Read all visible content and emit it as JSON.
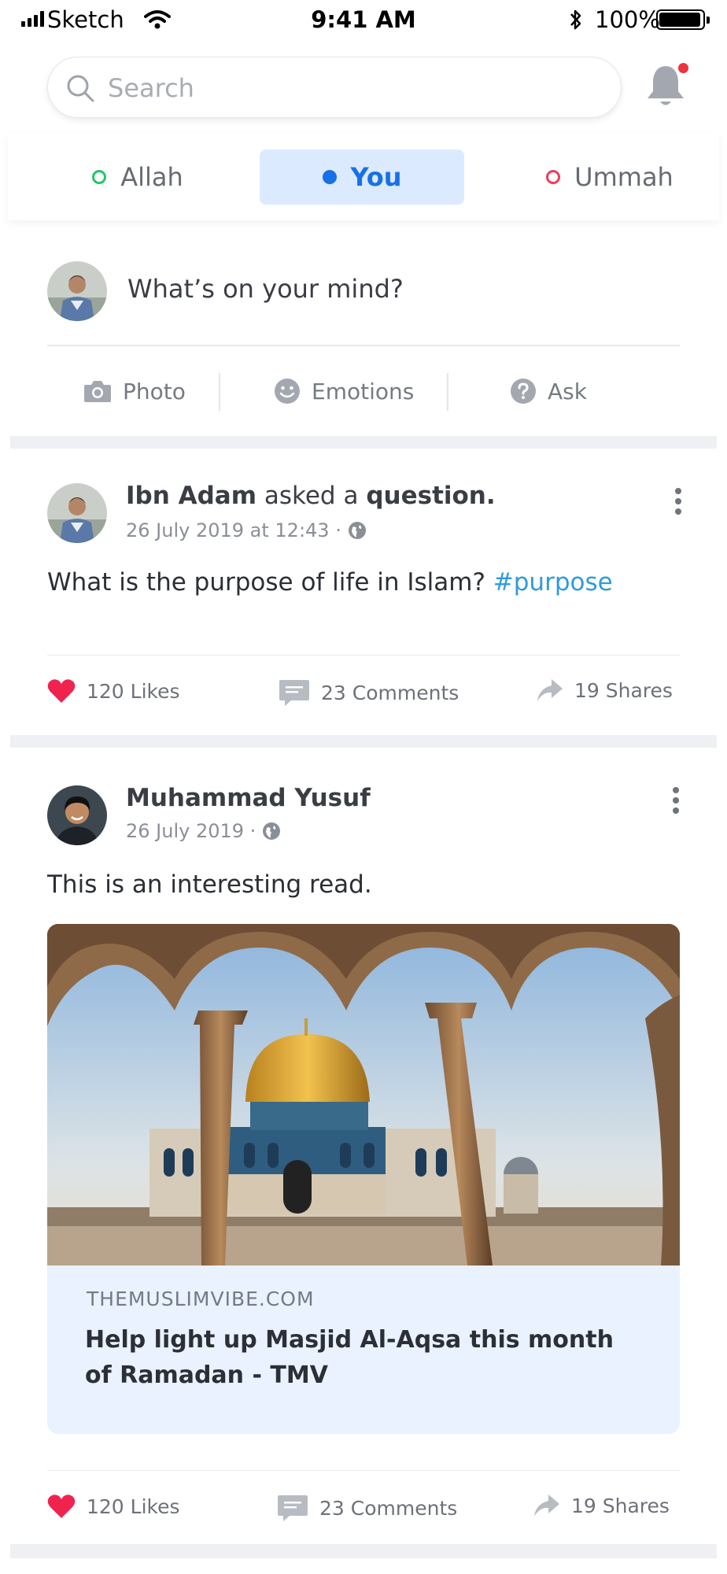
{
  "status_bar": {
    "carrier": "Sketch",
    "time": "9:41 AM",
    "battery": "100%"
  },
  "search": {
    "placeholder": "Search"
  },
  "tabs": [
    {
      "label": "Allah",
      "color": "#27c467"
    },
    {
      "label": "You",
      "color": "#1770e8"
    },
    {
      "label": "Ummah",
      "color": "#ee3d5d"
    }
  ],
  "composer": {
    "prompt": "What’s on your mind?",
    "actions": [
      {
        "label": "Photo",
        "icon": "camera-icon"
      },
      {
        "label": "Emotions",
        "icon": "smiley-icon"
      },
      {
        "label": "Ask",
        "icon": "question-icon"
      }
    ]
  },
  "posts": [
    {
      "author": "Ibn Adam",
      "action_prefix": "asked a",
      "action_object": "question.",
      "date": "26 July 2019 at 12:43 ·",
      "text": "What is the purpose of life in Islam?",
      "hashtag": "#purpose",
      "likes": "120 Likes",
      "comments": "23 Comments",
      "shares": "19 Shares"
    },
    {
      "author": "Muhammad Yusuf",
      "date": "26 July 2019 ·",
      "text": "This is an interesting read.",
      "link": {
        "domain": "THEMUSLIMVIBE.COM",
        "title": "Help light up Masjid Al-Aqsa this month of Ramadan - TMV"
      },
      "likes": "120 Likes",
      "comments": "23 Comments",
      "shares": "19 Shares"
    }
  ],
  "colors": {
    "accent": "#1770e8",
    "hashtag": "#2f9bdc",
    "like": "#f0234f",
    "notification_dot": "#f0323c"
  }
}
